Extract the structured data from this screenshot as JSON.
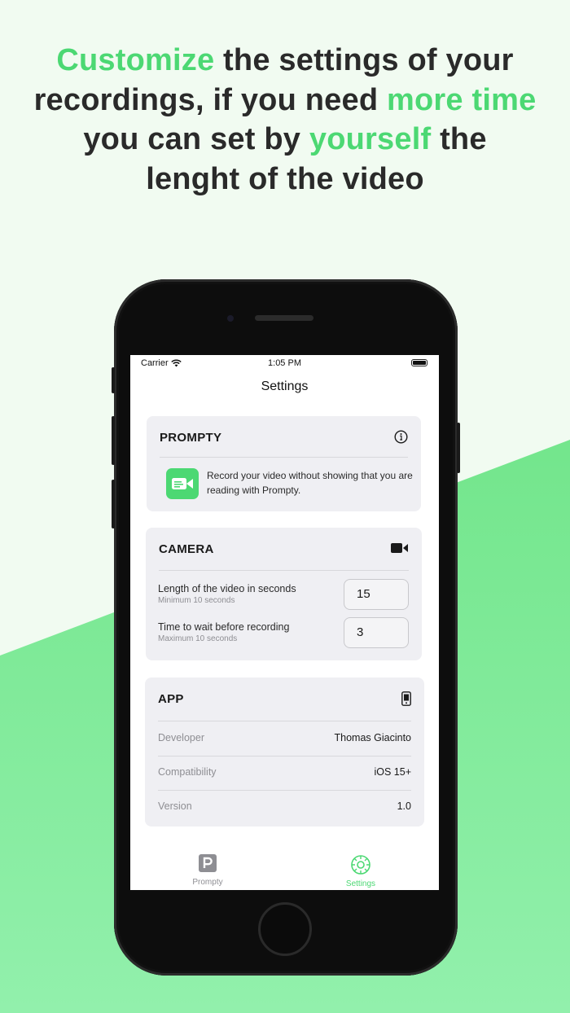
{
  "headline": {
    "p1": "Customize",
    "p2": " the settings of your recordings, if you need ",
    "p3": "more time",
    "p4": " you can set by ",
    "p5": "yourself",
    "p6": " the lenght of the video"
  },
  "colors": {
    "accent": "#4cd873",
    "background_top": "#f1fbf1",
    "background_green": "#5fe07c"
  },
  "status_bar": {
    "carrier": "Carrier",
    "time": "1:05 PM"
  },
  "nav": {
    "title": "Settings"
  },
  "prompty_card": {
    "title": "PROMPTY",
    "icon": "info-circle-icon",
    "description": "Record your video without showing that you are reading with Prompty."
  },
  "camera_card": {
    "title": "CAMERA",
    "icon": "video-camera-icon",
    "length_label": "Length of the video in seconds",
    "length_sub": "Minimum 10 seconds",
    "length_value": "15",
    "wait_label": "Time to wait before recording",
    "wait_sub": "Maximum 10 seconds",
    "wait_value": "3"
  },
  "app_card": {
    "title": "APP",
    "icon": "iphone-icon",
    "rows": [
      {
        "label": "Developer",
        "value": "Thomas Giacinto"
      },
      {
        "label": "Compatibility",
        "value": "iOS 15+"
      },
      {
        "label": "Version",
        "value": "1.0"
      }
    ]
  },
  "tabs": [
    {
      "label": "Prompty",
      "icon": "prompty-p-icon",
      "active": false
    },
    {
      "label": "Settings",
      "icon": "gear-icon",
      "active": true
    }
  ]
}
